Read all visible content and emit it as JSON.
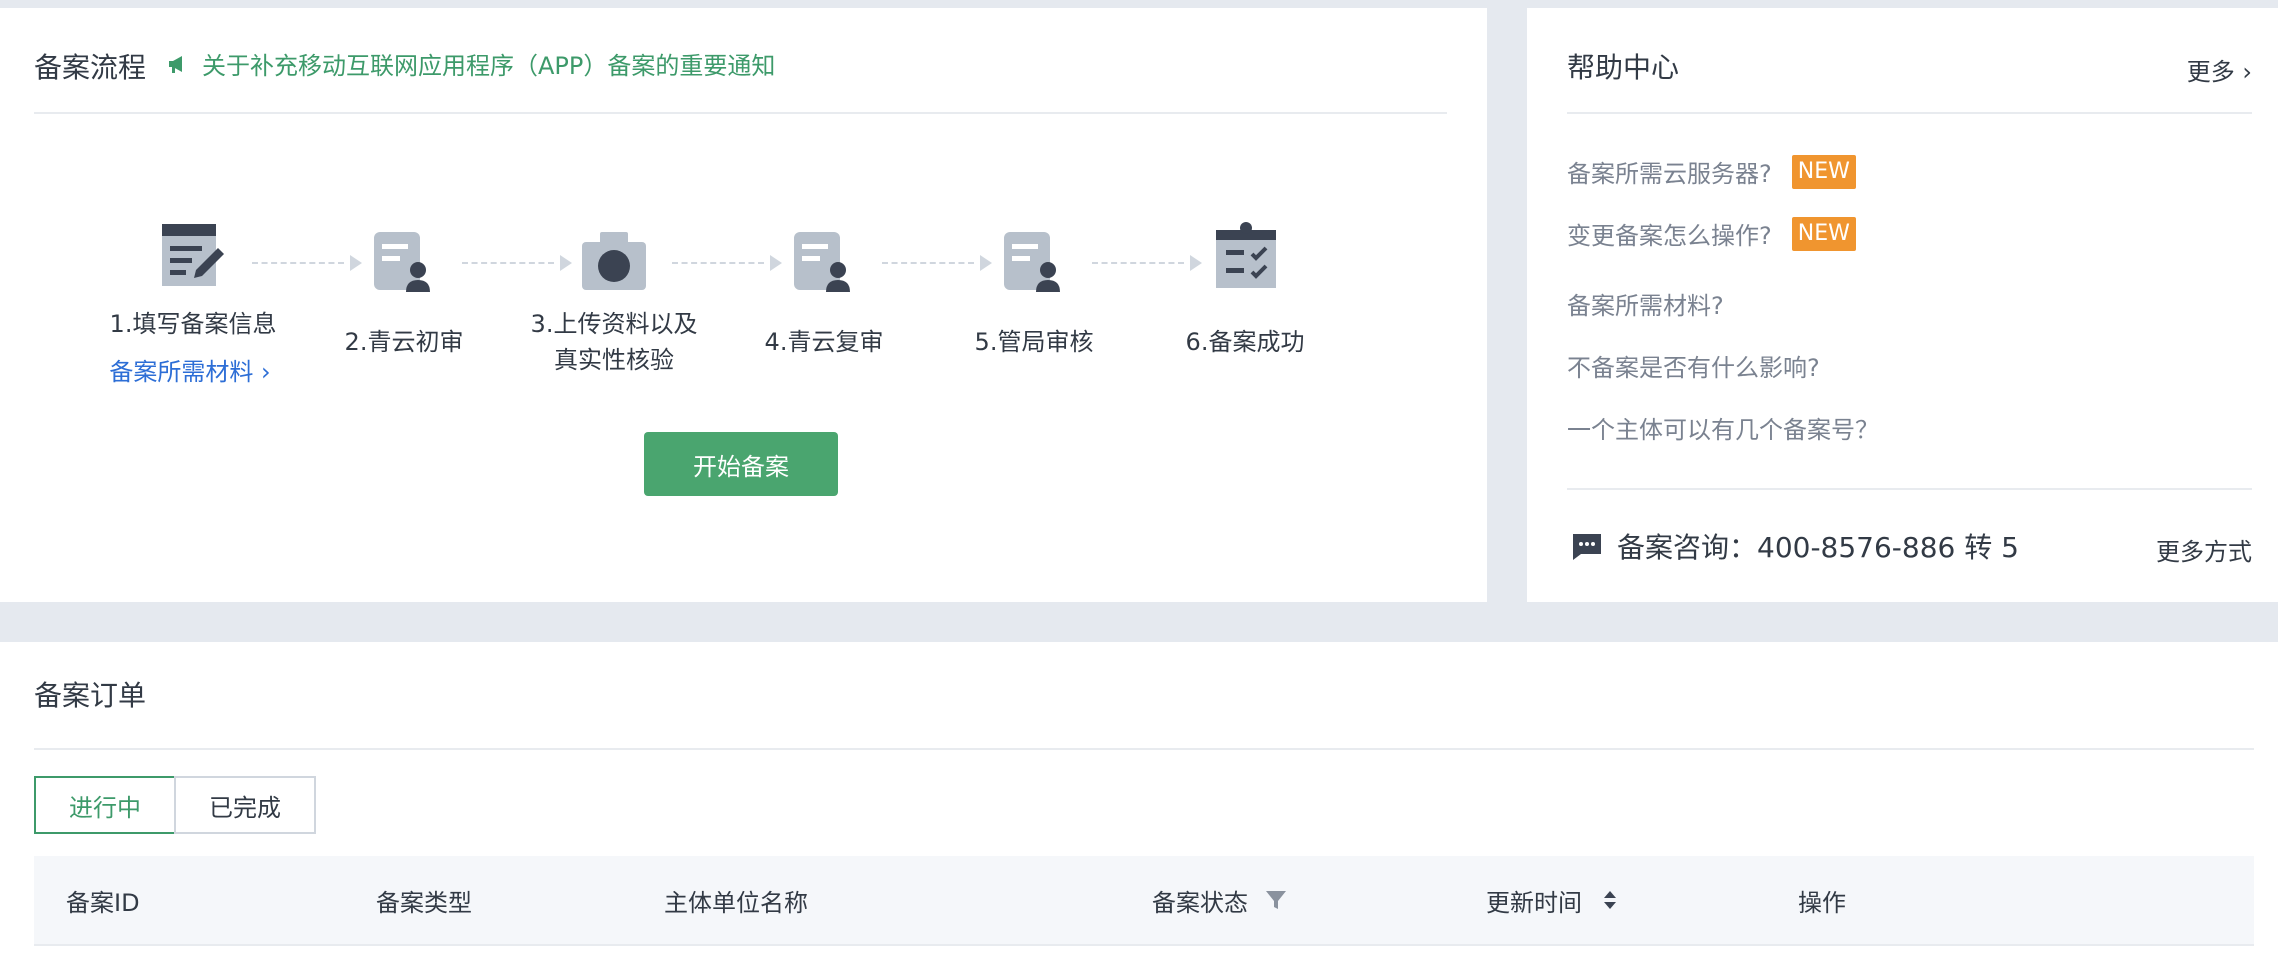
{
  "flow": {
    "title": "备案流程",
    "notice": "关于补充移动互联网应用程序（APP）备案的重要通知",
    "steps": [
      {
        "label_line1": "1.填写备案信息",
        "label_line2": "",
        "link": "备案所需材料 ›",
        "icon": "edit-form-icon"
      },
      {
        "label_line1": "2.青云初审",
        "label_line2": "",
        "icon": "review-document-icon"
      },
      {
        "label_line1": "3.上传资料以及",
        "label_line2": "真实性核验",
        "icon": "camera-icon"
      },
      {
        "label_line1": "4.青云复审",
        "label_line2": "",
        "icon": "review-document-icon"
      },
      {
        "label_line1": "5.管局审核",
        "label_line2": "",
        "icon": "review-document-icon"
      },
      {
        "label_line1": "6.备案成功",
        "label_line2": "",
        "icon": "clipboard-check-icon"
      }
    ],
    "start_button": "开始备案"
  },
  "help": {
    "title": "帮助中心",
    "more": "更多 ›",
    "faqs": [
      {
        "text": "备案所需云服务器?",
        "badge": "NEW"
      },
      {
        "text": "变更备案怎么操作?",
        "badge": "NEW"
      },
      {
        "text": "备案所需材料?",
        "badge": ""
      },
      {
        "text": "不备案是否有什么影响?",
        "badge": ""
      },
      {
        "text": "一个主体可以有几个备案号？",
        "badge": ""
      }
    ],
    "consult": "备案咨询：400-8576-886 转 5",
    "more_ways": "更多方式"
  },
  "orders": {
    "title": "备案订单",
    "tabs": [
      {
        "label": "进行中",
        "active": true
      },
      {
        "label": "已完成",
        "active": false
      }
    ],
    "columns": [
      "备案ID",
      "备案类型",
      "主体单位名称",
      "备案状态",
      "更新时间",
      "操作"
    ]
  },
  "colors": {
    "accent": "#4aa56f",
    "link": "#2d6ed6",
    "badge": "#f0952f",
    "icon": "#b7c0cb",
    "icon_dark": "#3b4352"
  }
}
